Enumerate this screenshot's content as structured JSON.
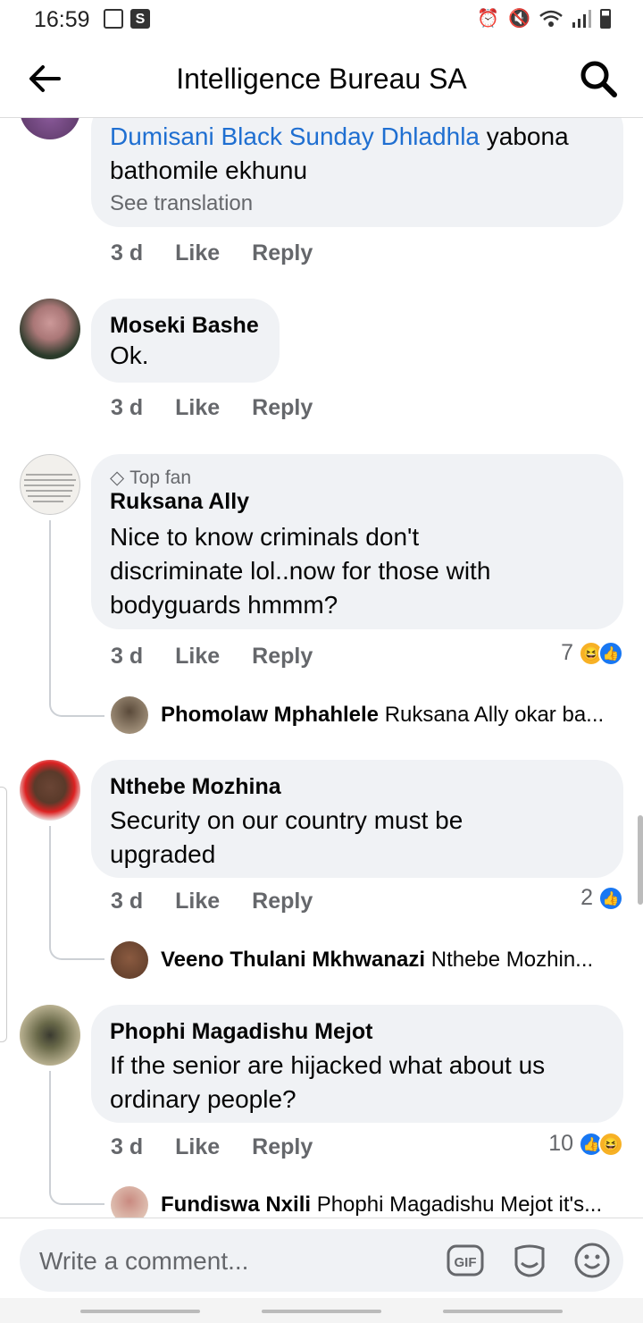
{
  "status": {
    "time": "16:59",
    "icon_left": [
      "image-icon",
      "s-icon"
    ],
    "icon_right": [
      "alarm-icon",
      "mute-icon",
      "wifi-icon",
      "signal-icon",
      "battery-icon"
    ]
  },
  "header": {
    "title": "Intelligence Bureau SA"
  },
  "comments": [
    {
      "mention": "Dumisani Black Sunday Dhladhla",
      "line1": " yabona",
      "line2": "bathomile ekhunu",
      "see_translation": "See translation",
      "time": "3 d",
      "like": "Like",
      "reply": "Reply"
    },
    {
      "author": "Moseki Bashe",
      "text": "Ok.",
      "time": "3 d",
      "like": "Like",
      "reply": "Reply"
    },
    {
      "badge": "Top fan",
      "author": "Ruksana Ally",
      "line1": "Nice to know criminals don't",
      "line2": "discriminate lol..now for those with",
      "line3": "bodyguards hmmm?",
      "time": "3 d",
      "like": "Like",
      "reply": "Reply",
      "reaction_count": "7",
      "reply_preview": {
        "name": "Phomolaw Mphahlele",
        "text": "Ruksana Ally okar ba..."
      }
    },
    {
      "author": "Nthebe Mozhina",
      "line1": "Security on our country must be",
      "line2": "upgraded",
      "time": "3 d",
      "like": "Like",
      "reply": "Reply",
      "reaction_count": "2",
      "reply_preview": {
        "name": "Veeno Thulani Mkhwanazi",
        "text": "Nthebe Mozhin..."
      }
    },
    {
      "author": "Phophi Magadishu Mejot",
      "line1": "If the senior are hijacked what about us",
      "line2": "ordinary people?",
      "time": "3 d",
      "like": "Like",
      "reply": "Reply",
      "reaction_count": "10",
      "reply_preview": {
        "name": "Fundiswa Nxili",
        "text": "Phophi Magadishu Mejot it's..."
      }
    }
  ],
  "composer": {
    "placeholder": "Write a comment...",
    "gif_label": "GIF"
  },
  "colors": {
    "link": "#1f6fd1",
    "bubble": "#f0f2f5",
    "meta": "#65676b",
    "like_blue": "#1877f2",
    "haha_yellow": "#f7b125"
  }
}
